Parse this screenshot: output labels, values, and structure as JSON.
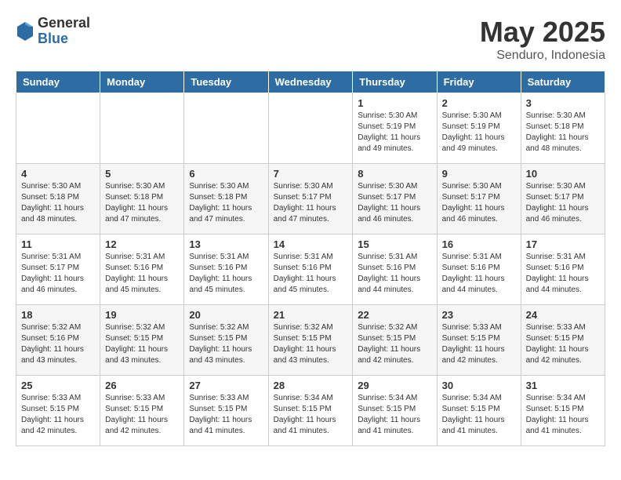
{
  "logo": {
    "general": "General",
    "blue": "Blue"
  },
  "title": "May 2025",
  "location": "Senduro, Indonesia",
  "days_of_week": [
    "Sunday",
    "Monday",
    "Tuesday",
    "Wednesday",
    "Thursday",
    "Friday",
    "Saturday"
  ],
  "weeks": [
    [
      {
        "day": "",
        "info": ""
      },
      {
        "day": "",
        "info": ""
      },
      {
        "day": "",
        "info": ""
      },
      {
        "day": "",
        "info": ""
      },
      {
        "day": "1",
        "info": "Sunrise: 5:30 AM\nSunset: 5:19 PM\nDaylight: 11 hours\nand 49 minutes."
      },
      {
        "day": "2",
        "info": "Sunrise: 5:30 AM\nSunset: 5:19 PM\nDaylight: 11 hours\nand 49 minutes."
      },
      {
        "day": "3",
        "info": "Sunrise: 5:30 AM\nSunset: 5:18 PM\nDaylight: 11 hours\nand 48 minutes."
      }
    ],
    [
      {
        "day": "4",
        "info": "Sunrise: 5:30 AM\nSunset: 5:18 PM\nDaylight: 11 hours\nand 48 minutes."
      },
      {
        "day": "5",
        "info": "Sunrise: 5:30 AM\nSunset: 5:18 PM\nDaylight: 11 hours\nand 47 minutes."
      },
      {
        "day": "6",
        "info": "Sunrise: 5:30 AM\nSunset: 5:18 PM\nDaylight: 11 hours\nand 47 minutes."
      },
      {
        "day": "7",
        "info": "Sunrise: 5:30 AM\nSunset: 5:17 PM\nDaylight: 11 hours\nand 47 minutes."
      },
      {
        "day": "8",
        "info": "Sunrise: 5:30 AM\nSunset: 5:17 PM\nDaylight: 11 hours\nand 46 minutes."
      },
      {
        "day": "9",
        "info": "Sunrise: 5:30 AM\nSunset: 5:17 PM\nDaylight: 11 hours\nand 46 minutes."
      },
      {
        "day": "10",
        "info": "Sunrise: 5:30 AM\nSunset: 5:17 PM\nDaylight: 11 hours\nand 46 minutes."
      }
    ],
    [
      {
        "day": "11",
        "info": "Sunrise: 5:31 AM\nSunset: 5:17 PM\nDaylight: 11 hours\nand 46 minutes."
      },
      {
        "day": "12",
        "info": "Sunrise: 5:31 AM\nSunset: 5:16 PM\nDaylight: 11 hours\nand 45 minutes."
      },
      {
        "day": "13",
        "info": "Sunrise: 5:31 AM\nSunset: 5:16 PM\nDaylight: 11 hours\nand 45 minutes."
      },
      {
        "day": "14",
        "info": "Sunrise: 5:31 AM\nSunset: 5:16 PM\nDaylight: 11 hours\nand 45 minutes."
      },
      {
        "day": "15",
        "info": "Sunrise: 5:31 AM\nSunset: 5:16 PM\nDaylight: 11 hours\nand 44 minutes."
      },
      {
        "day": "16",
        "info": "Sunrise: 5:31 AM\nSunset: 5:16 PM\nDaylight: 11 hours\nand 44 minutes."
      },
      {
        "day": "17",
        "info": "Sunrise: 5:31 AM\nSunset: 5:16 PM\nDaylight: 11 hours\nand 44 minutes."
      }
    ],
    [
      {
        "day": "18",
        "info": "Sunrise: 5:32 AM\nSunset: 5:16 PM\nDaylight: 11 hours\nand 43 minutes."
      },
      {
        "day": "19",
        "info": "Sunrise: 5:32 AM\nSunset: 5:15 PM\nDaylight: 11 hours\nand 43 minutes."
      },
      {
        "day": "20",
        "info": "Sunrise: 5:32 AM\nSunset: 5:15 PM\nDaylight: 11 hours\nand 43 minutes."
      },
      {
        "day": "21",
        "info": "Sunrise: 5:32 AM\nSunset: 5:15 PM\nDaylight: 11 hours\nand 43 minutes."
      },
      {
        "day": "22",
        "info": "Sunrise: 5:32 AM\nSunset: 5:15 PM\nDaylight: 11 hours\nand 42 minutes."
      },
      {
        "day": "23",
        "info": "Sunrise: 5:33 AM\nSunset: 5:15 PM\nDaylight: 11 hours\nand 42 minutes."
      },
      {
        "day": "24",
        "info": "Sunrise: 5:33 AM\nSunset: 5:15 PM\nDaylight: 11 hours\nand 42 minutes."
      }
    ],
    [
      {
        "day": "25",
        "info": "Sunrise: 5:33 AM\nSunset: 5:15 PM\nDaylight: 11 hours\nand 42 minutes."
      },
      {
        "day": "26",
        "info": "Sunrise: 5:33 AM\nSunset: 5:15 PM\nDaylight: 11 hours\nand 42 minutes."
      },
      {
        "day": "27",
        "info": "Sunrise: 5:33 AM\nSunset: 5:15 PM\nDaylight: 11 hours\nand 41 minutes."
      },
      {
        "day": "28",
        "info": "Sunrise: 5:34 AM\nSunset: 5:15 PM\nDaylight: 11 hours\nand 41 minutes."
      },
      {
        "day": "29",
        "info": "Sunrise: 5:34 AM\nSunset: 5:15 PM\nDaylight: 11 hours\nand 41 minutes."
      },
      {
        "day": "30",
        "info": "Sunrise: 5:34 AM\nSunset: 5:15 PM\nDaylight: 11 hours\nand 41 minutes."
      },
      {
        "day": "31",
        "info": "Sunrise: 5:34 AM\nSunset: 5:15 PM\nDaylight: 11 hours\nand 41 minutes."
      }
    ]
  ]
}
